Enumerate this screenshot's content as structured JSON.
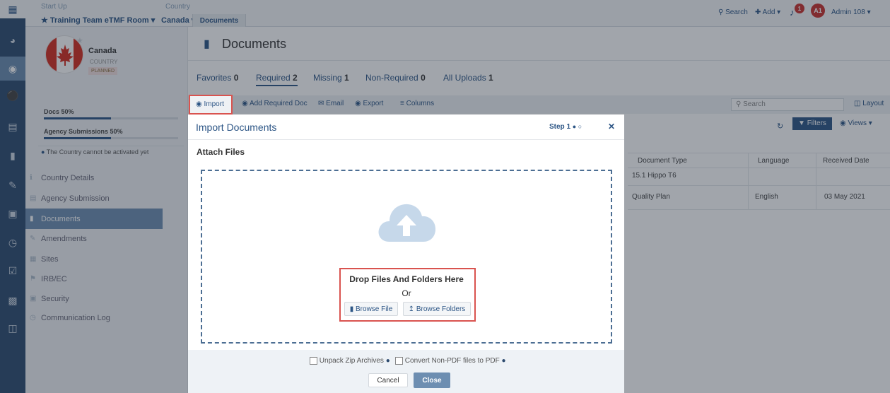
{
  "topbar": {
    "start_label": "Start Up",
    "room_label": "Training Team eTMF Room",
    "country_label": "Country",
    "country_value": "Canada",
    "documents_tab": "Documents",
    "search": "Search",
    "add": "Add",
    "notif_count": "1",
    "avatar_initials": "A1",
    "user": "Admin 108"
  },
  "profile": {
    "name": "Canada",
    "type": "COUNTRY",
    "status": "PLANNED"
  },
  "progress": [
    {
      "label": "Docs 50%",
      "value": 0.5
    },
    {
      "label": "Agency Submissions 50%",
      "value": 0.5
    }
  ],
  "notice": "The Country cannot be activated yet",
  "nav": [
    {
      "label": "Country Details",
      "icon": "info-icon"
    },
    {
      "label": "Agency Submission",
      "icon": "id-card-icon"
    },
    {
      "label": "Documents",
      "icon": "file-icon"
    },
    {
      "label": "Amendments",
      "icon": "edit-icon"
    },
    {
      "label": "Sites",
      "icon": "building-icon"
    },
    {
      "label": "IRB/EC",
      "icon": "bank-icon"
    },
    {
      "label": "Security",
      "icon": "lock-icon"
    },
    {
      "label": "Communication Log",
      "icon": "clock-icon"
    }
  ],
  "page": {
    "title": "Documents",
    "tabs": [
      {
        "label": "Favorites",
        "count": "0"
      },
      {
        "label": "Required",
        "count": "2"
      },
      {
        "label": "Missing",
        "count": "1"
      },
      {
        "label": "Non-Required",
        "count": "0"
      },
      {
        "label": "All Uploads",
        "count": "1"
      }
    ]
  },
  "toolbar": {
    "import": "Import",
    "add_required": "Add Required Doc",
    "email": "Email",
    "export": "Export",
    "columns": "Columns",
    "search_placeholder": "Search",
    "layout": "Layout",
    "filters": "Filters",
    "views": "Views"
  },
  "table": {
    "headers": [
      "Document Type",
      "Language",
      "Received Date"
    ],
    "rows": [
      [
        "15.1 Hippo T6",
        "",
        ""
      ],
      [
        "Quality Plan",
        "English",
        "03 May 2021"
      ]
    ]
  },
  "dialog": {
    "title": "Import Documents",
    "step": "Step 1",
    "section": "Attach Files",
    "drop_text": "Drop Files And Folders Here",
    "or": "Or",
    "browse_file": "Browse File",
    "browse_folders": "Browse Folders",
    "unpack": "Unpack Zip Archives",
    "convert": "Convert Non-PDF files to PDF",
    "cancel": "Cancel",
    "close": "Close"
  },
  "colors": {
    "rail": "#2c4a6e",
    "accent": "#2c5585",
    "highlight": "#d9534f"
  }
}
